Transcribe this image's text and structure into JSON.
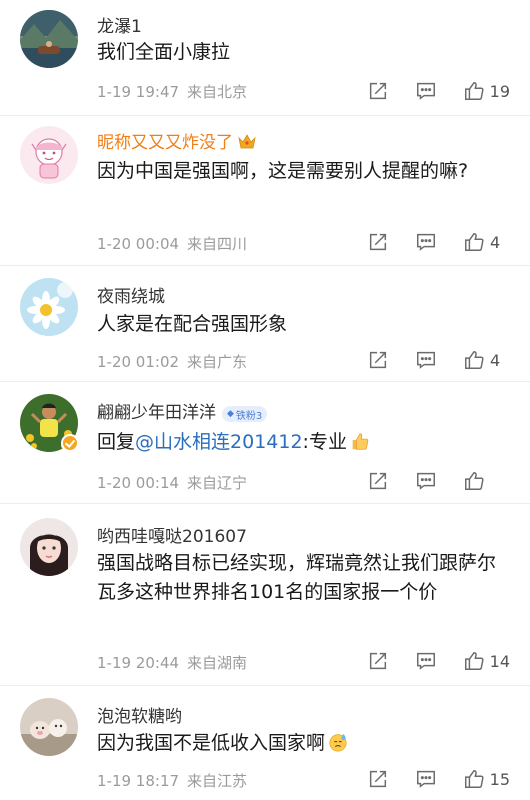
{
  "comments": [
    {
      "username": "龙瀑1",
      "text": "我们全面小康拉",
      "date": "1-19 19:47",
      "location": "来自北京",
      "likes": "19"
    },
    {
      "username": "昵称又又又炸没了",
      "text": "因为中国是强国啊，这是需要别人提醒的嘛?",
      "date": "1-20 00:04",
      "location": "来自四川",
      "likes": "4"
    },
    {
      "username": "夜雨绕城",
      "text": "人家是在配合强国形象",
      "date": "1-20 01:02",
      "location": "来自广东",
      "likes": "4"
    },
    {
      "username": "翩翩少年田洋洋",
      "badge": "铁粉3",
      "text_prefix": "回复",
      "mention": "@山水相连201412",
      "text_suffix": ":专业",
      "date": "1-20 00:14",
      "location": "来自辽宁",
      "likes": ""
    },
    {
      "username": "哟西哇嘎哒201607",
      "text": "强国战略目标已经实现，辉瑞竟然让我们跟萨尔瓦多这种世界排名101名的国家报一个价",
      "date": "1-19 20:44",
      "location": "来自湖南",
      "likes": "14"
    },
    {
      "username": "泡泡软糖哟",
      "text": "因为我国不是低收入国家啊",
      "date": "1-19 18:17",
      "location": "来自江苏",
      "likes": "15"
    }
  ],
  "colors": {
    "username_vip": "#f07f17",
    "mention": "#2a6ebd",
    "meta": "#9b9b9b",
    "badge_bg": "#e6eefb",
    "verified": "#f5a623"
  },
  "icons": [
    "share-icon",
    "comment-icon",
    "like-icon",
    "thumbs-up-emoji",
    "sweat-emoji",
    "crown-icon",
    "verified-badge-icon"
  ]
}
